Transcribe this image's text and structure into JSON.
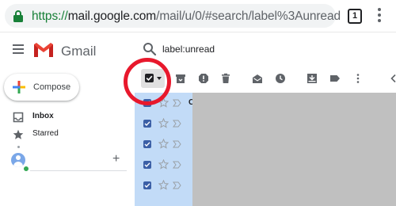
{
  "browser": {
    "url_scheme": "https://",
    "url_host": "mail.google.com",
    "url_path": "/mail/u/0/#search/label%3Aunread",
    "tab_count": "1"
  },
  "app": {
    "wordmark": "Gmail"
  },
  "search": {
    "query": "label:unread"
  },
  "sidebar": {
    "compose_label": "Compose",
    "items": [
      {
        "label": "Inbox",
        "icon": "inbox-icon"
      },
      {
        "label": "Starred",
        "icon": "star-icon"
      }
    ],
    "new_conversation": "+"
  },
  "toolbar": {
    "icons": [
      "archive-icon",
      "report-spam-icon",
      "delete-icon",
      "mark-as-read-icon",
      "snooze-icon",
      "move-to-icon",
      "label-icon",
      "more-options-icon",
      "chevron-left-icon"
    ]
  },
  "email_list": {
    "rows": [
      {
        "sender": "C",
        "selected": true
      },
      {
        "sender": "",
        "selected": true
      },
      {
        "sender": "",
        "selected": true
      },
      {
        "sender": "",
        "selected": true
      },
      {
        "sender": "",
        "selected": true
      }
    ]
  },
  "colors": {
    "selected_row": "#c2dbf7",
    "annotation_circle": "#e8182c",
    "secure_scheme": "#188038"
  }
}
